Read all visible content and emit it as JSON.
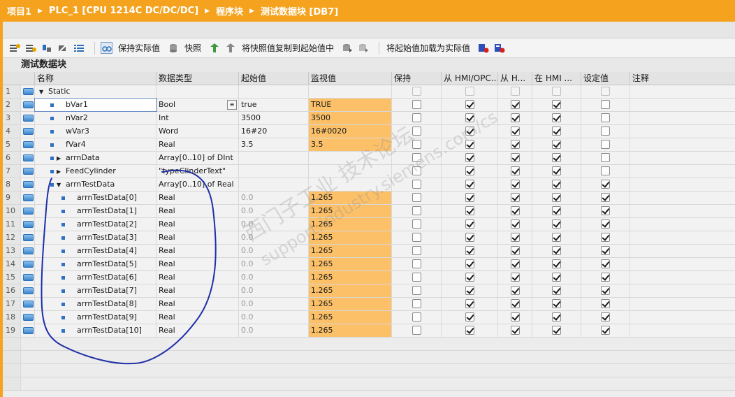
{
  "breadcrumb": {
    "project": "项目1",
    "plc": "PLC_1 [CPU 1214C DC/DC/DC]",
    "folder": "程序块",
    "block": "测试数据块 [DB7]"
  },
  "toolbar": {
    "keep_actual_label": "保持实际值",
    "snapshot_label": "快照",
    "copy_snapshot_label": "将快照值复制到起始值中",
    "load_start_label": "将起始值加载为实际值"
  },
  "block_title": "测试数据块",
  "columns": {
    "name": "名称",
    "datatype": "数据类型",
    "start": "起始值",
    "monitor": "监视值",
    "retain": "保持",
    "hmi_opc": "从 HMI/OPC...",
    "hmi_short": "从 H...",
    "in_hmi": "在 HMI ...",
    "setpoint": "设定值",
    "comment": "注释"
  },
  "rows": [
    {
      "num": "1",
      "name": "Static",
      "type": "",
      "start": "",
      "monitor": "",
      "level": 0,
      "expand": "open",
      "dot": false,
      "checks": [
        "dis",
        "dis",
        "dis",
        "dis",
        "dis"
      ],
      "mon_on": false
    },
    {
      "num": "2",
      "name": "bVar1",
      "type": "Bool",
      "start": "true",
      "monitor": "TRUE",
      "level": 1,
      "expand": "",
      "dot": true,
      "checks": [
        "off",
        "on",
        "on",
        "on",
        "off"
      ],
      "mon_on": true
    },
    {
      "num": "3",
      "name": "nVar2",
      "type": "Int",
      "start": "3500",
      "monitor": "3500",
      "level": 1,
      "expand": "",
      "dot": true,
      "checks": [
        "off",
        "on",
        "on",
        "on",
        "off"
      ],
      "mon_on": true
    },
    {
      "num": "4",
      "name": "wVar3",
      "type": "Word",
      "start": "16#20",
      "monitor": "16#0020",
      "level": 1,
      "expand": "",
      "dot": true,
      "checks": [
        "off",
        "on",
        "on",
        "on",
        "off"
      ],
      "mon_on": true
    },
    {
      "num": "5",
      "name": "fVar4",
      "type": "Real",
      "start": "3.5",
      "monitor": "3.5",
      "level": 1,
      "expand": "",
      "dot": true,
      "checks": [
        "off",
        "on",
        "on",
        "on",
        "off"
      ],
      "mon_on": true
    },
    {
      "num": "6",
      "name": "arrnData",
      "type": "Array[0..10] of DInt",
      "start": "",
      "monitor": "",
      "level": 1,
      "expand": "closed",
      "dot": true,
      "checks": [
        "off",
        "on",
        "on",
        "on",
        "off"
      ],
      "mon_on": false
    },
    {
      "num": "7",
      "name": "FeedCylinder",
      "type": "\"typeClinderText\"",
      "start": "",
      "monitor": "",
      "level": 1,
      "expand": "closed",
      "dot": true,
      "checks": [
        "off",
        "on",
        "on",
        "on",
        "off"
      ],
      "mon_on": false
    },
    {
      "num": "8",
      "name": "arrnTestData",
      "type": "Array[0..10] of Real",
      "start": "",
      "monitor": "",
      "level": 1,
      "expand": "open",
      "dot": true,
      "checks": [
        "off",
        "on",
        "on",
        "on",
        "on"
      ],
      "mon_on": false
    },
    {
      "num": "9",
      "name": "arrnTestData[0]",
      "type": "Real",
      "start": "0.0",
      "monitor": "1.265",
      "level": 2,
      "expand": "",
      "dot": true,
      "checks": [
        "off",
        "on",
        "on",
        "on",
        "on"
      ],
      "mon_on": true
    },
    {
      "num": "10",
      "name": "arrnTestData[1]",
      "type": "Real",
      "start": "0.0",
      "monitor": "1.265",
      "level": 2,
      "expand": "",
      "dot": true,
      "checks": [
        "off",
        "on",
        "on",
        "on",
        "on"
      ],
      "mon_on": true
    },
    {
      "num": "11",
      "name": "arrnTestData[2]",
      "type": "Real",
      "start": "0.0",
      "monitor": "1.265",
      "level": 2,
      "expand": "",
      "dot": true,
      "checks": [
        "off",
        "on",
        "on",
        "on",
        "on"
      ],
      "mon_on": true
    },
    {
      "num": "12",
      "name": "arrnTestData[3]",
      "type": "Real",
      "start": "0.0",
      "monitor": "1.265",
      "level": 2,
      "expand": "",
      "dot": true,
      "checks": [
        "off",
        "on",
        "on",
        "on",
        "on"
      ],
      "mon_on": true
    },
    {
      "num": "13",
      "name": "arrnTestData[4]",
      "type": "Real",
      "start": "0.0",
      "monitor": "1.265",
      "level": 2,
      "expand": "",
      "dot": true,
      "checks": [
        "off",
        "on",
        "on",
        "on",
        "on"
      ],
      "mon_on": true
    },
    {
      "num": "14",
      "name": "arrnTestData[5]",
      "type": "Real",
      "start": "0.0",
      "monitor": "1.265",
      "level": 2,
      "expand": "",
      "dot": true,
      "checks": [
        "off",
        "on",
        "on",
        "on",
        "on"
      ],
      "mon_on": true
    },
    {
      "num": "15",
      "name": "arrnTestData[6]",
      "type": "Real",
      "start": "0.0",
      "monitor": "1.265",
      "level": 2,
      "expand": "",
      "dot": true,
      "checks": [
        "off",
        "on",
        "on",
        "on",
        "on"
      ],
      "mon_on": true
    },
    {
      "num": "16",
      "name": "arrnTestData[7]",
      "type": "Real",
      "start": "0.0",
      "monitor": "1.265",
      "level": 2,
      "expand": "",
      "dot": true,
      "checks": [
        "off",
        "on",
        "on",
        "on",
        "on"
      ],
      "mon_on": true
    },
    {
      "num": "17",
      "name": "arrnTestData[8]",
      "type": "Real",
      "start": "0.0",
      "monitor": "1.265",
      "level": 2,
      "expand": "",
      "dot": true,
      "checks": [
        "off",
        "on",
        "on",
        "on",
        "on"
      ],
      "mon_on": true
    },
    {
      "num": "18",
      "name": "arrnTestData[9]",
      "type": "Real",
      "start": "0.0",
      "monitor": "1.265",
      "level": 2,
      "expand": "",
      "dot": true,
      "checks": [
        "off",
        "on",
        "on",
        "on",
        "on"
      ],
      "mon_on": true
    },
    {
      "num": "19",
      "name": "arrnTestData[10]",
      "type": "Real",
      "start": "0.0",
      "monitor": "1.265",
      "level": 2,
      "expand": "",
      "dot": true,
      "checks": [
        "off",
        "on",
        "on",
        "on",
        "on"
      ],
      "mon_on": true
    }
  ],
  "watermark": {
    "line1": "西门子工业  技术论坛",
    "line2": "support.industry.siemens.com/cs"
  },
  "colors": {
    "accent": "#f5a31f",
    "monitor_highlight": "#fcc168",
    "annotation_ink": "#1f2fa8"
  },
  "icons": {
    "row": "db-tag-icon",
    "entry": "blue-square-bullet"
  }
}
